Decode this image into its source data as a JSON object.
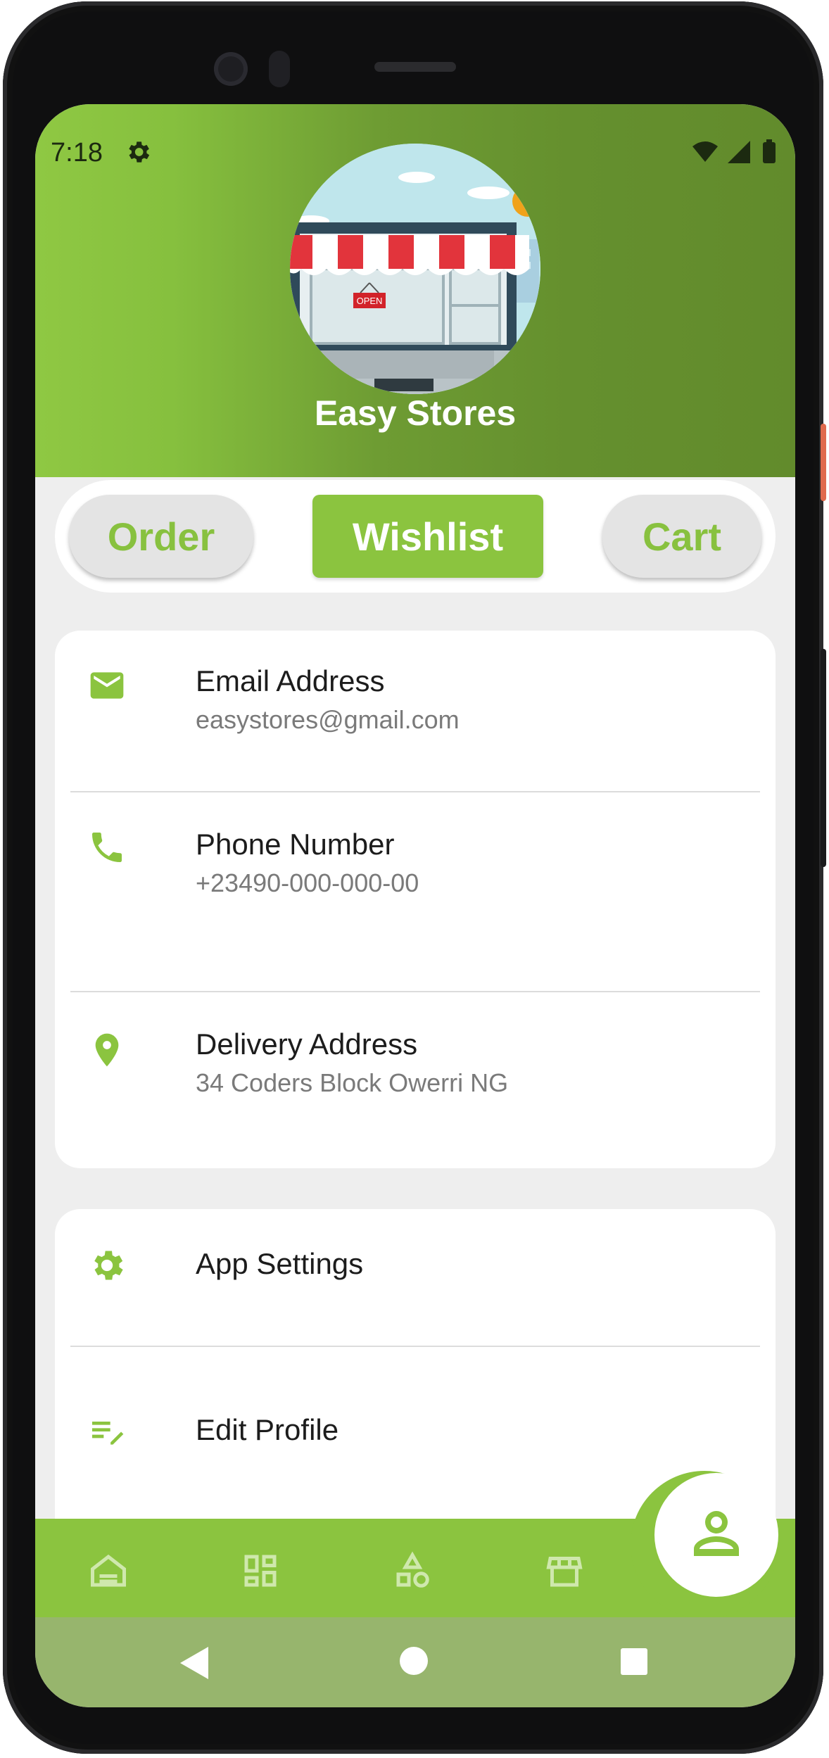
{
  "status_bar": {
    "time": "7:18"
  },
  "profile": {
    "store_name": "Easy Stores",
    "sign_text": "OPEN"
  },
  "tabs": [
    {
      "label": "Order",
      "active": false
    },
    {
      "label": "Wishlist",
      "active": true
    },
    {
      "label": "Cart",
      "active": false
    }
  ],
  "contact": {
    "email": {
      "title": "Email Address",
      "value": "easystores@gmail.com",
      "icon": "mail-icon"
    },
    "phone": {
      "title": "Phone Number",
      "value": "+23490-000-000-00",
      "icon": "phone-icon"
    },
    "address": {
      "title": "Delivery Address",
      "value": "34 Coders Block Owerri NG",
      "icon": "location-pin-icon"
    }
  },
  "settings": {
    "app_settings": {
      "title": "App Settings",
      "icon": "gear-icon"
    },
    "edit_profile": {
      "title": "Edit Profile",
      "icon": "edit-note-icon"
    }
  },
  "bottom_nav": {
    "items": [
      "home-icon",
      "grid-icon",
      "categories-icon",
      "store-icon",
      "profile-icon"
    ],
    "active": "profile-icon"
  },
  "colors": {
    "accent": "#8bc43f",
    "header_dark": "#628b2c",
    "system_nav": "#97b56d"
  }
}
